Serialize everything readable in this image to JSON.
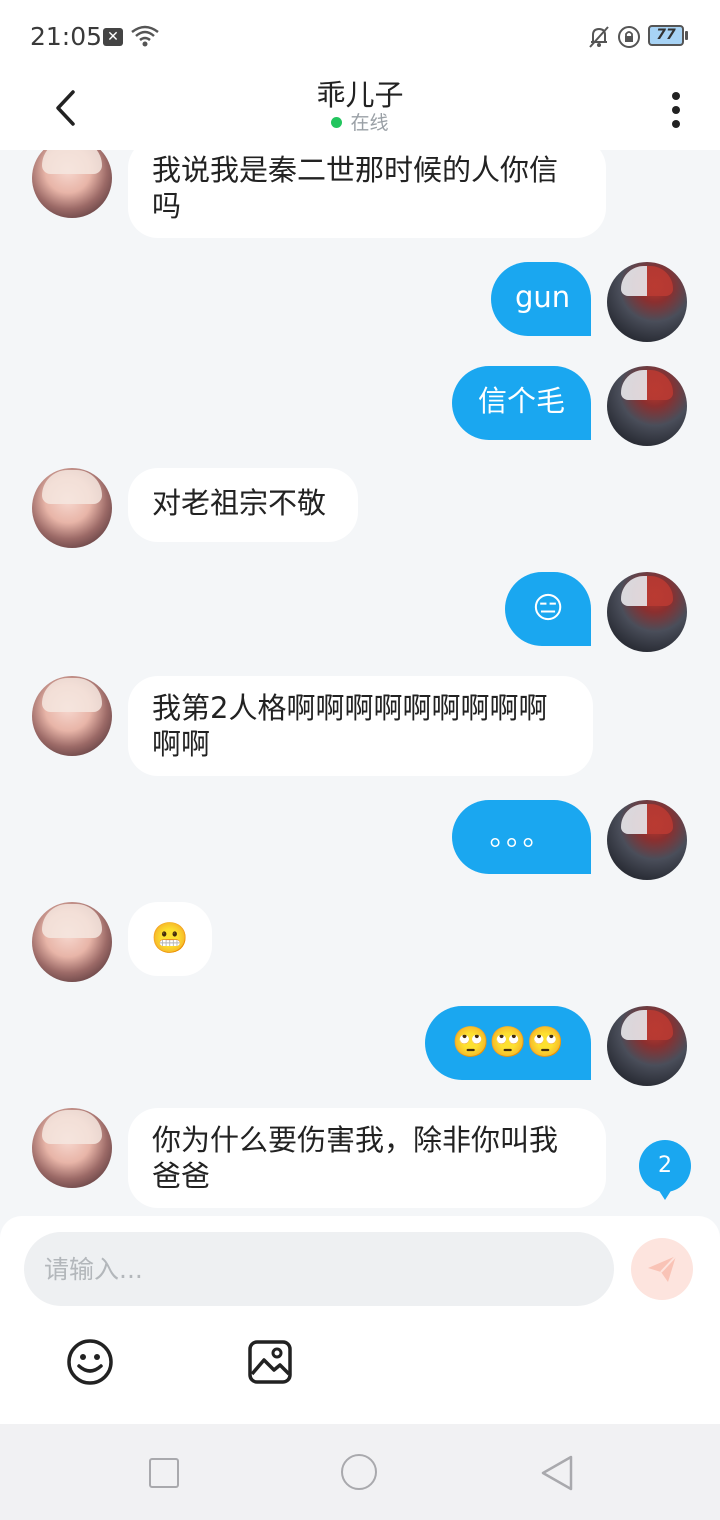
{
  "status_bar": {
    "time": "21:05",
    "battery": "77"
  },
  "header": {
    "title": "乖儿子",
    "status": "在线"
  },
  "messages": [
    {
      "side": "left",
      "text": "我说我是秦二世那时候的人你信\n吗"
    },
    {
      "side": "right",
      "text": "gun"
    },
    {
      "side": "right",
      "text": "信个毛"
    },
    {
      "side": "left",
      "text": "对老祖宗不敬"
    },
    {
      "side": "right",
      "text": "😑"
    },
    {
      "side": "left",
      "text": "我第2人格啊啊啊啊啊啊啊啊啊\n啊啊"
    },
    {
      "side": "right",
      "text": "。。。"
    },
    {
      "side": "left",
      "text": "😬"
    },
    {
      "side": "right",
      "text": "🙄🙄🙄"
    },
    {
      "side": "left",
      "text": "你为什么要伤害我，除非你叫我\n爸爸"
    }
  ],
  "unread_badge": "2",
  "composer": {
    "placeholder": "请输入..."
  },
  "icons": {
    "back": "chevron-left-icon",
    "more": "more-vertical-icon",
    "send": "send-icon",
    "emoji": "smiley-icon",
    "image": "image-icon"
  },
  "colors": {
    "accent": "#1aa7f0",
    "online": "#22c55e",
    "send_bg": "#fde4de"
  }
}
